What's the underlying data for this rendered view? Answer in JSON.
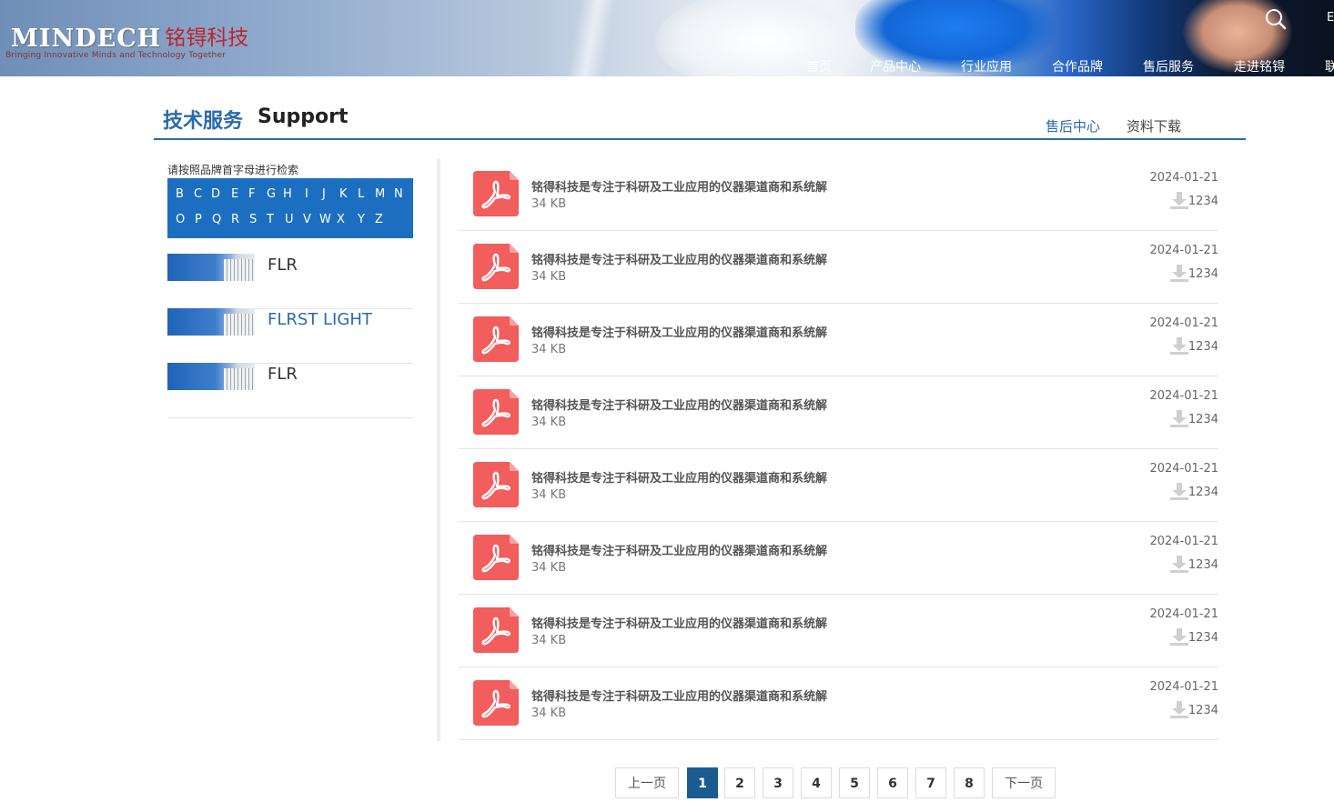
{
  "header": {
    "logo_en": "MINDECH",
    "logo_cn": "铭锝科技",
    "tagline": "Bringing Innovative Minds and Technology Together",
    "nav": [
      "首页",
      "产品中心",
      "行业应用",
      "合作品牌",
      "售后服务",
      "走进铭锝",
      "联"
    ],
    "lang": "E",
    "search_icon": "search-icon"
  },
  "section": {
    "title_cn": "技术服务",
    "title_en": "Support",
    "links": [
      "售后中心",
      "资料下载"
    ],
    "accent_color": "#2a6aac"
  },
  "sidebar": {
    "hint": "请按照品牌首字母进行检索",
    "letters_row1": [
      "B",
      "C",
      "D",
      "E",
      "F",
      "G",
      "H",
      "I",
      "J",
      "K",
      "L",
      "M",
      "N"
    ],
    "letters_row2": [
      "O",
      "P",
      "Q",
      "R",
      "S",
      "T",
      "U",
      "V",
      "W",
      "X",
      "Y",
      "Z"
    ],
    "brands": [
      {
        "name": "FLR",
        "color": "#333333"
      },
      {
        "name": "FLRST LIGHT",
        "color": "#2a6aac"
      },
      {
        "name": "FLR",
        "color": "#333333"
      }
    ]
  },
  "documents": [
    {
      "title": "铭得科技是专注于科研及工业应用的仪器渠道商和系统解",
      "size": "34 KB",
      "date": "2024-01-21",
      "downloads": "1234"
    },
    {
      "title": "铭得科技是专注于科研及工业应用的仪器渠道商和系统解",
      "size": "34 KB",
      "date": "2024-01-21",
      "downloads": "1234"
    },
    {
      "title": "铭得科技是专注于科研及工业应用的仪器渠道商和系统解",
      "size": "34 KB",
      "date": "2024-01-21",
      "downloads": "1234"
    },
    {
      "title": "铭得科技是专注于科研及工业应用的仪器渠道商和系统解",
      "size": "34 KB",
      "date": "2024-01-21",
      "downloads": "1234"
    },
    {
      "title": "铭得科技是专注于科研及工业应用的仪器渠道商和系统解",
      "size": "34 KB",
      "date": "2024-01-21",
      "downloads": "1234"
    },
    {
      "title": "铭得科技是专注于科研及工业应用的仪器渠道商和系统解",
      "size": "34 KB",
      "date": "2024-01-21",
      "downloads": "1234"
    },
    {
      "title": "铭得科技是专注于科研及工业应用的仪器渠道商和系统解",
      "size": "34 KB",
      "date": "2024-01-21",
      "downloads": "1234"
    },
    {
      "title": "铭得科技是专注于科研及工业应用的仪器渠道商和系统解",
      "size": "34 KB",
      "date": "2024-01-21",
      "downloads": "1234"
    }
  ],
  "pagination": {
    "prev": "上一页",
    "pages": [
      "1",
      "2",
      "3",
      "4",
      "5",
      "6",
      "7",
      "8"
    ],
    "current": "1",
    "next": "下一页"
  },
  "colors": {
    "pdf_red": "#f25d5d",
    "letter_bg": "#1c6fc0",
    "pager_active": "#1a5c92"
  }
}
